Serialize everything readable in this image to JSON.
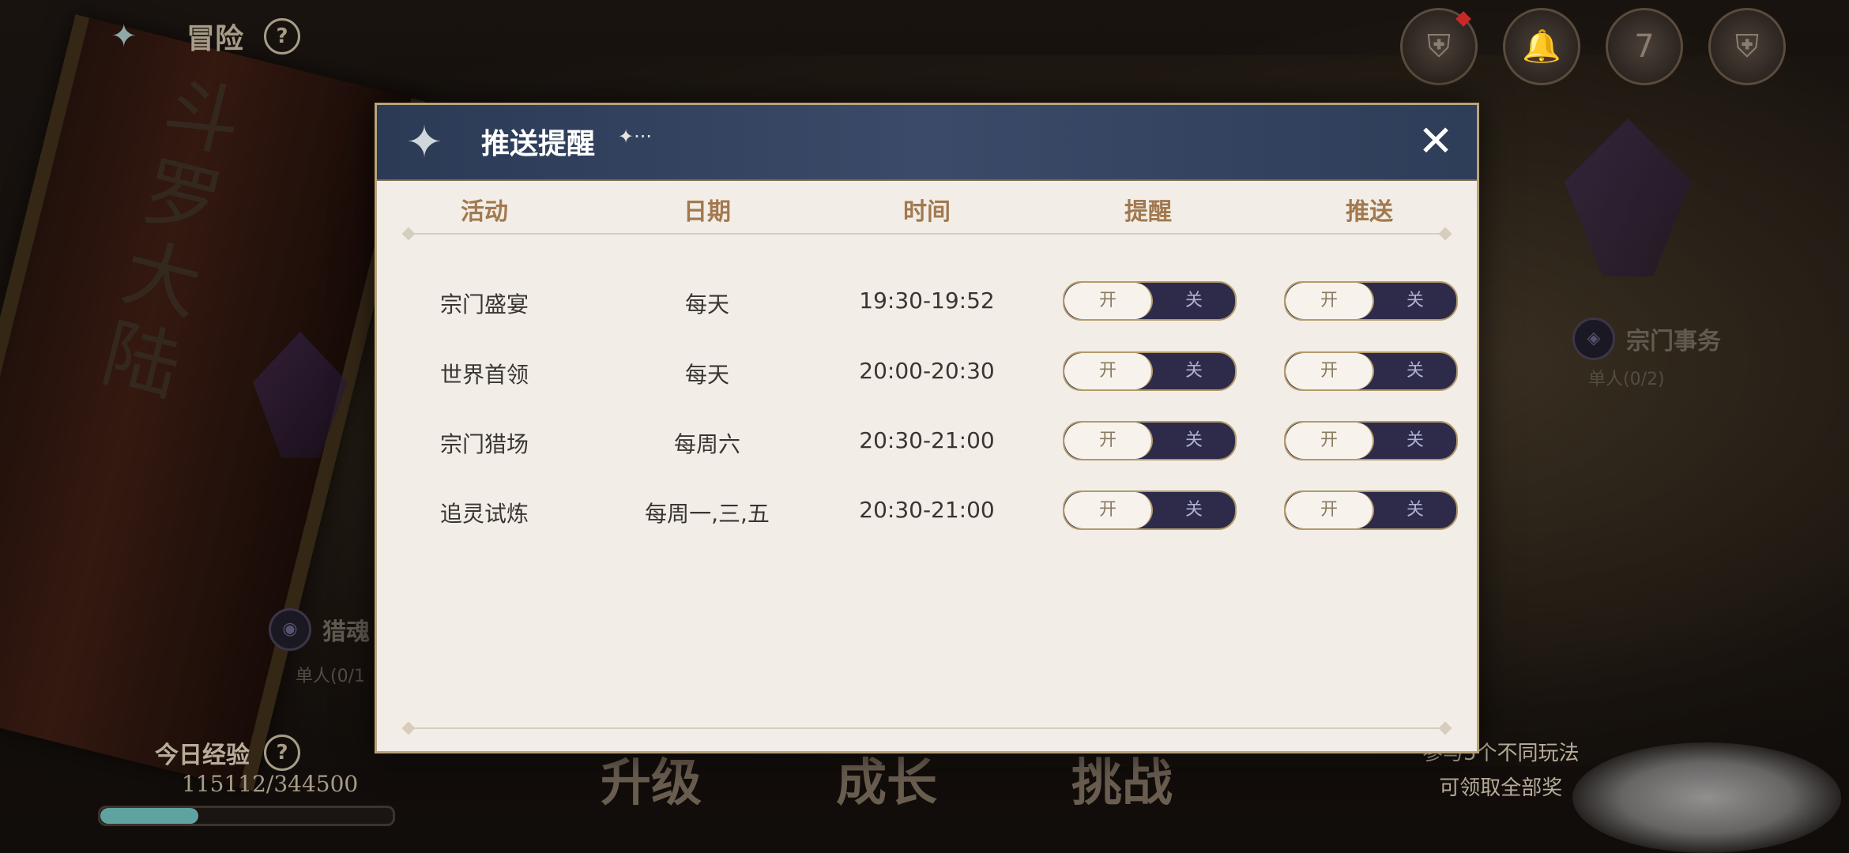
{
  "top_bar": {
    "title": "冒险",
    "help": "?",
    "icons": [
      "shield-icon",
      "bell-settings-icon",
      "calendar-icon",
      "shield-icon"
    ],
    "calendar_day": "7"
  },
  "background": {
    "scroll_text": "斗罗大陆",
    "left_node": {
      "label": "猎魂",
      "sub": "单人(0/1"
    },
    "right_node": {
      "label": "宗门事务",
      "sub": "单人(0/2)"
    }
  },
  "bottom_bar": {
    "exp_label": "今日经验",
    "exp_value": "115112/344500",
    "exp_progress": 0.334,
    "tabs": [
      "升级",
      "成长",
      "挑战"
    ],
    "reward_line1": "参与5个不同玩法",
    "reward_line2": "可领取全部奖"
  },
  "modal": {
    "title": "推送提醒",
    "title_deco": "✦···",
    "columns": [
      "活动",
      "日期",
      "时间",
      "提醒",
      "推送"
    ],
    "toggle_on_label": "开",
    "toggle_off_label": "关",
    "rows": [
      {
        "activity": "宗门盛宴",
        "date": "每天",
        "time": "19:30-19:52",
        "remind": "off",
        "push": "off"
      },
      {
        "activity": "世界首领",
        "date": "每天",
        "time": "20:00-20:30",
        "remind": "off",
        "push": "off"
      },
      {
        "activity": "宗门猎场",
        "date": "每周六",
        "time": "20:30-21:00",
        "remind": "off",
        "push": "off"
      },
      {
        "activity": "追灵试炼",
        "date": "每周一,三,五",
        "time": "20:30-21:00",
        "remind": "off",
        "push": "off"
      }
    ]
  }
}
